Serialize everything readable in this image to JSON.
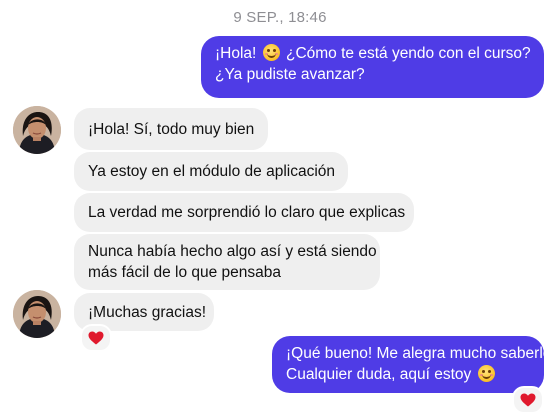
{
  "conversation": {
    "timestamp": "9 SEP., 18:46",
    "messages": [
      {
        "from": "me",
        "lines": [
          "¡Hola! 😊 ¿Cómo te está yendo con el curso?",
          "¿Ya pudiste avanzar?"
        ],
        "line1_a": "¡Hola!",
        "line1_b": "¿Cómo te está yendo con el curso?",
        "line2": "¿Ya pudiste avanzar?"
      },
      {
        "from": "contact",
        "text": "¡Hola! Sí, todo muy bien"
      },
      {
        "from": "contact",
        "text": "Ya estoy en el módulo de aplicación"
      },
      {
        "from": "contact",
        "text": "La verdad me sorprendió lo claro que explicas"
      },
      {
        "from": "contact",
        "line1": "Nunca había hecho algo así y está siendo",
        "line2": "más fácil de lo que pensaba"
      },
      {
        "from": "contact",
        "text": "¡Muchas gracias!",
        "reaction": "heart"
      },
      {
        "from": "me",
        "line1": "¡Qué bueno! Me alegra mucho saberlo.",
        "line2_a": "Cualquier duda, aquí estoy",
        "reaction": "heart"
      }
    ]
  },
  "colors": {
    "outgoing_bubble": "#4f3ce6",
    "incoming_bubble": "#efefef",
    "timestamp": "#8e8e93",
    "heart": "#e0192d"
  },
  "icons": {
    "emoji": "smiling-face-icon",
    "reaction": "red-heart-icon",
    "avatar": "contact-avatar"
  }
}
